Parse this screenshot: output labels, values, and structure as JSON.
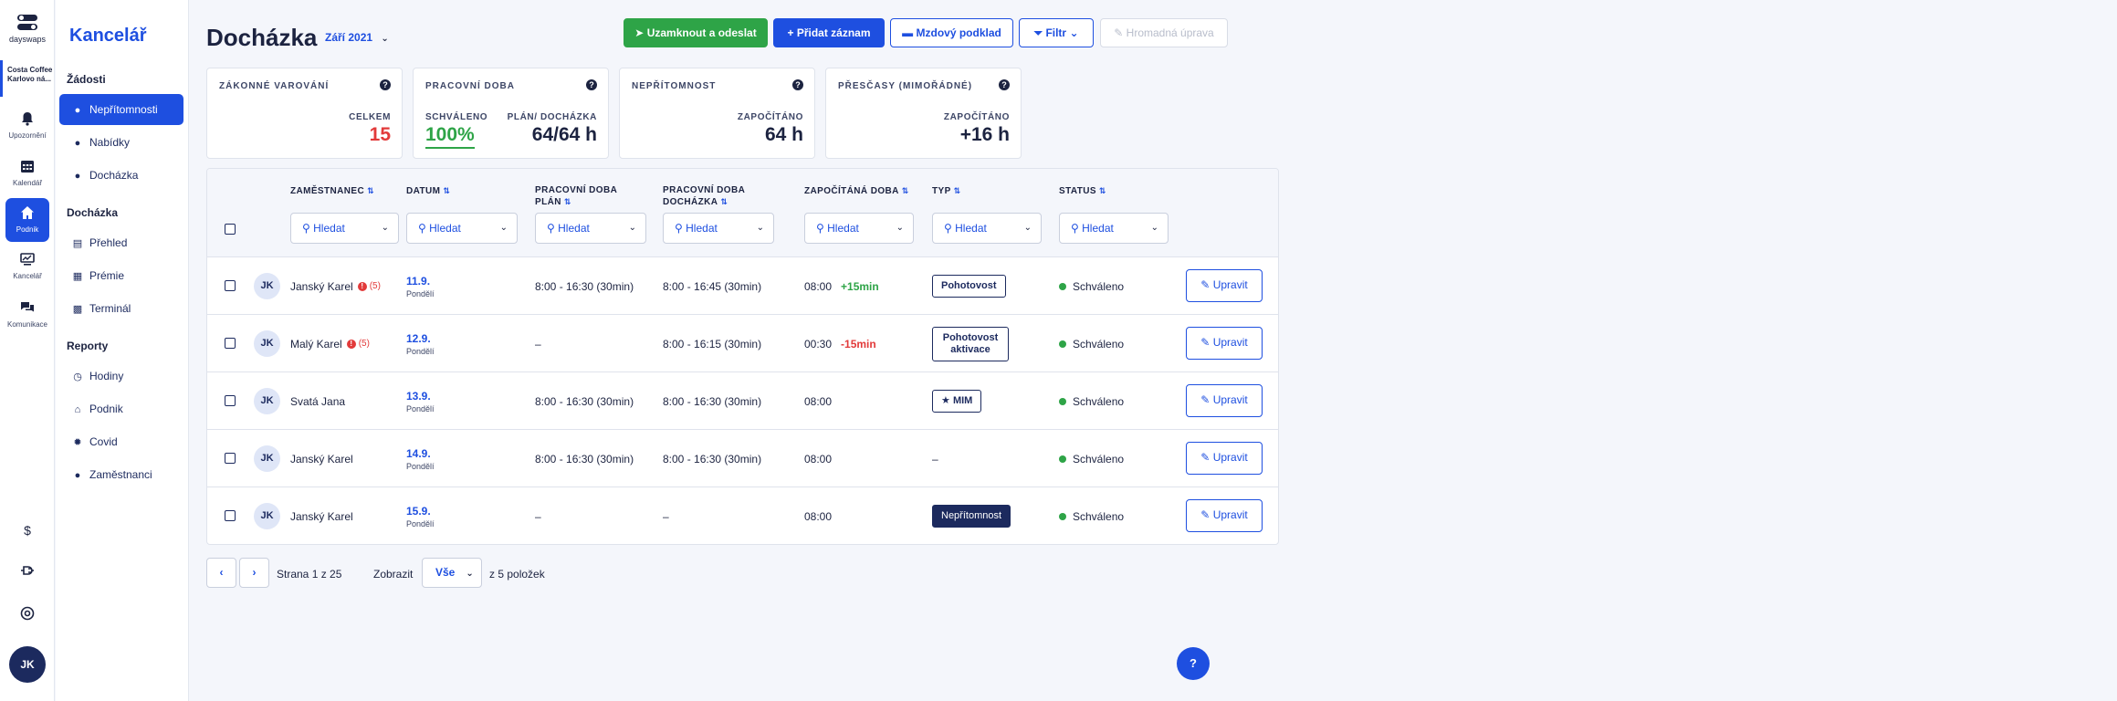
{
  "rail": {
    "logo_text": "dayswaps",
    "venue": "Costa Coffee Karlovo ná...",
    "items": [
      {
        "label": "Upozornění",
        "icon": "bell-icon"
      },
      {
        "label": "Kalendář",
        "icon": "calendar-icon"
      },
      {
        "label": "Podnik",
        "icon": "home-icon"
      },
      {
        "label": "Kancelář",
        "icon": "office-icon"
      },
      {
        "label": "Komunikace",
        "icon": "chat-icon"
      }
    ],
    "bottom_icons": [
      "dollar-icon",
      "plug-icon",
      "support-icon"
    ],
    "user_initials": "JK"
  },
  "sidebar": {
    "title": "Kancelář",
    "sections": [
      {
        "title": "Žádosti",
        "items": [
          {
            "label": "Nepřítomnosti"
          },
          {
            "label": "Nabídky"
          },
          {
            "label": "Docházka"
          }
        ]
      },
      {
        "title": "Docházka",
        "items": [
          {
            "label": "Přehled"
          },
          {
            "label": "Prémie"
          },
          {
            "label": "Terminál"
          }
        ]
      },
      {
        "title": "Reporty",
        "items": [
          {
            "label": "Hodiny"
          },
          {
            "label": "Podnik"
          },
          {
            "label": "Covid"
          },
          {
            "label": "Zaměstnanci"
          }
        ]
      }
    ]
  },
  "header": {
    "title": "Docházka",
    "period": "Září 2021",
    "buttons": {
      "lock": "Uzamknout a odeslat",
      "add": "Přidat záznam",
      "payroll": "Mzdový podklad",
      "filter": "Filtr",
      "bulk": "Hromadná úprava"
    }
  },
  "cards": {
    "legal": {
      "title": "ZÁKONNÉ VAROVÁNÍ",
      "label": "CELKEM",
      "value": "15"
    },
    "worktime": {
      "title": "PRACOVNÍ DOBA",
      "label1": "SCHVÁLENO",
      "value1": "100%",
      "label2": "PLÁN/ DOCHÁZKA",
      "value2": "64/64 h"
    },
    "absence": {
      "title": "NEPŘÍTOMNOST",
      "label": "ZAPOČÍTÁNO",
      "value": "64 h"
    },
    "overtime": {
      "title": "PŘESČASY (MIMOŘÁDNÉ)",
      "label": "ZAPOČÍTÁNO",
      "value": "+16 h"
    }
  },
  "table": {
    "columns": {
      "employee": "ZAMĚSTNANEC",
      "date": "DATUM",
      "plan": "PRACOVNÍ DOBA PLÁN",
      "attendance": "PRACOVNÍ DOBA DOCHÁZKA",
      "counted": "ZAPOČÍTÁNÁ DOBA",
      "type": "TYP",
      "status": "STATUS"
    },
    "search_placeholder": "Hledat",
    "edit_label": "Upravit",
    "rows": [
      {
        "initials": "JK",
        "name": "Janský Karel",
        "warning": "(5)",
        "date": "11.9.",
        "day": "Pondělí",
        "plan": "8:00 - 16:30 (30min)",
        "attendance": "8:00 - 16:45 (30min)",
        "counted": "08:00",
        "delta": "+15min",
        "type": "Pohotovost",
        "status": "Schváleno"
      },
      {
        "initials": "JK",
        "name": "Malý Karel",
        "warning": "(5)",
        "date": "12.9.",
        "day": "Pondělí",
        "plan": "–",
        "attendance": "8:00 - 16:15 (30min)",
        "counted": "00:30",
        "delta": "-15min",
        "type": "Pohotovost aktivace",
        "status": "Schváleno"
      },
      {
        "initials": "JK",
        "name": "Svatá Jana",
        "warning": "",
        "date": "13.9.",
        "day": "Pondělí",
        "plan": "8:00 - 16:30 (30min)",
        "attendance": "8:00 - 16:30 (30min)",
        "counted": "08:00",
        "delta": "",
        "type": "MIM",
        "status": "Schváleno"
      },
      {
        "initials": "JK",
        "name": "Janský Karel",
        "warning": "",
        "date": "14.9.",
        "day": "Pondělí",
        "plan": "8:00 - 16:30 (30min)",
        "attendance": "8:00 - 16:30 (30min)",
        "counted": "08:00",
        "delta": "",
        "type": "–",
        "status": "Schváleno"
      },
      {
        "initials": "JK",
        "name": "Janský Karel",
        "warning": "",
        "date": "15.9.",
        "day": "Pondělí",
        "plan": "–",
        "attendance": "–",
        "counted": "08:00",
        "delta": "",
        "type": "Nepřítomnost",
        "status": "Schváleno"
      }
    ]
  },
  "pagination": {
    "page_text": "Strana 1 z 25",
    "show_label": "Zobrazit",
    "show_value": "Vše",
    "total_text": "z 5 položek"
  },
  "help_label": "?",
  "colors": {
    "accent": "#1e4fe0",
    "success": "#2ea447",
    "danger": "#e23a3a",
    "navy": "#1c2a5e"
  }
}
